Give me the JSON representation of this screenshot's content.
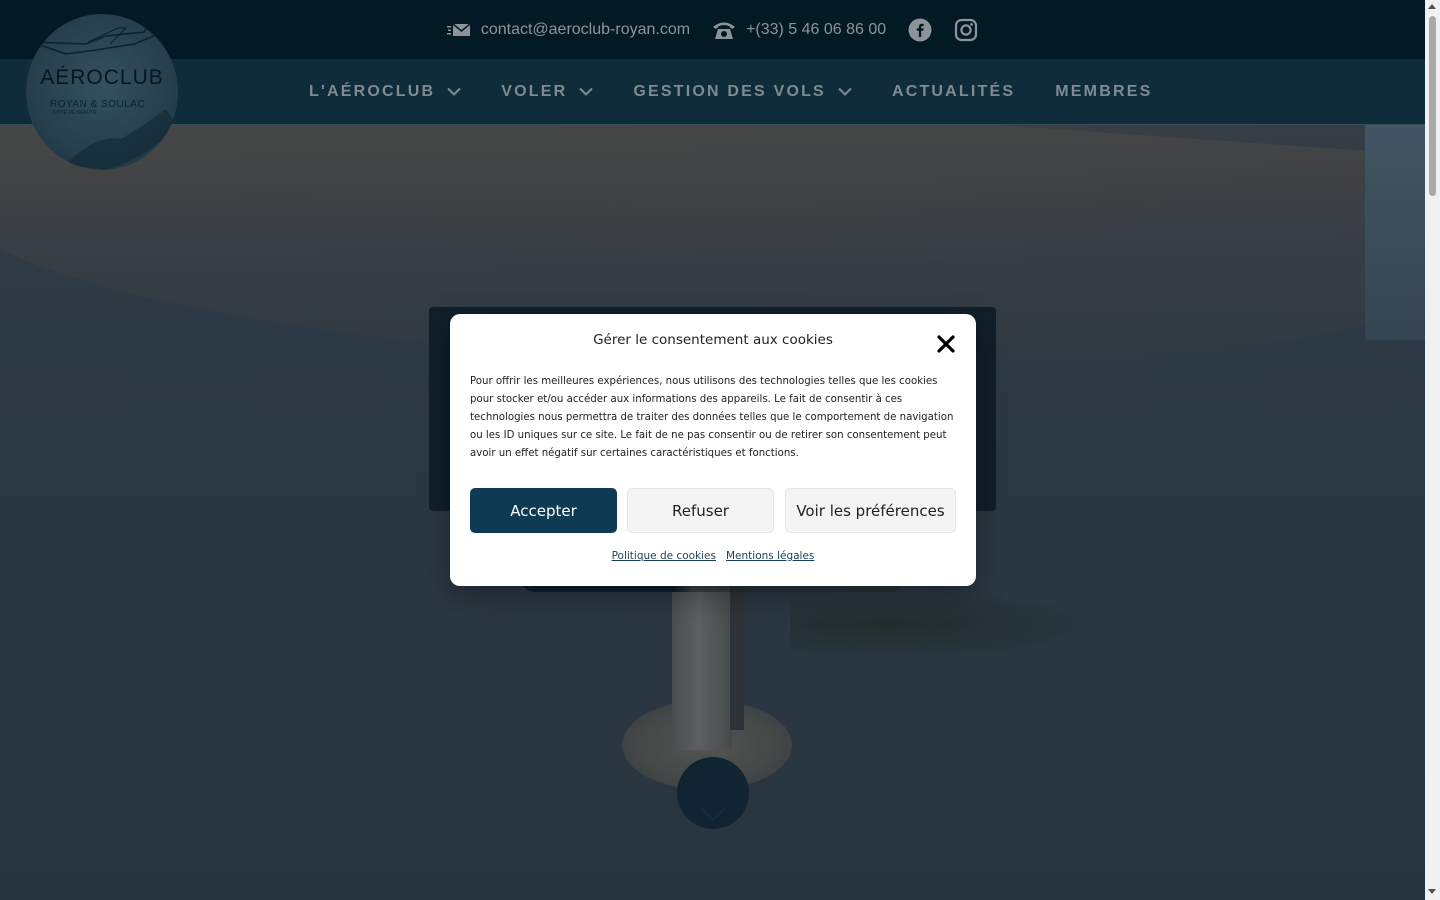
{
  "contact": {
    "email": "contact@aeroclub-royan.com",
    "phone": "+(33) 5 46 06 86 00"
  },
  "icons": {
    "email": "email-icon",
    "phone": "phone-icon",
    "facebook": "facebook-icon",
    "instagram": "instagram-icon",
    "chevron": "chevron-down-icon"
  },
  "logo": {
    "title": "AÉROCLUB",
    "subtitle": "ROYAN & SOULAC",
    "tagline": "CÔTE DE BEAUTÉ"
  },
  "nav": {
    "items": [
      {
        "label": "L'AÉROCLUB"
      },
      {
        "label": "VOLER"
      },
      {
        "label": "GESTION DES VOLS"
      },
      {
        "label": "ACTUALITÉS"
      },
      {
        "label": "MEMBRES"
      }
    ]
  },
  "cookie_modal": {
    "title": "Gérer le consentement aux cookies",
    "text": "Pour offrir les meilleures expériences, nous utilisons des technologies telles que les cookies pour stocker et/ou accéder aux informations des appareils. Le fait de consentir à ces technologies nous permettra de traiter des données telles que le comportement de navigation ou les ID uniques sur ce site. Le fait de ne pas consentir ou de retirer son consentement peut avoir un effet négatif sur certaines caractéristiques et fonctions.",
    "accept_label": "Accepter",
    "refuse_label": "Refuser",
    "prefs_label": "Voir les préférences",
    "policy_link": "Politique de cookies",
    "legal_link": "Mentions légales"
  },
  "colors": {
    "topbar": "#031a24",
    "navbar": "#0e2c3a",
    "accept_button": "#0e3b53",
    "modal_bg": "#ffffff"
  }
}
